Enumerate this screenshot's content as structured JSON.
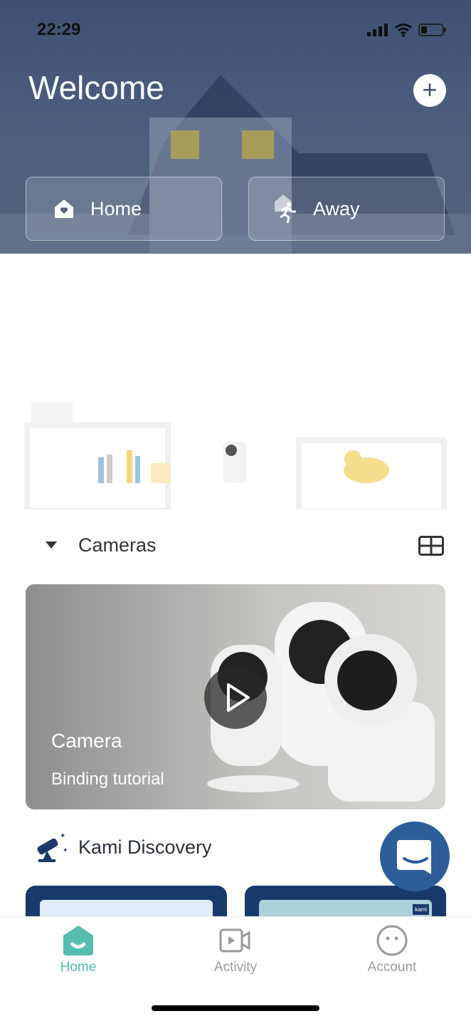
{
  "status_bar": {
    "time": "22:29"
  },
  "header": {
    "title": "Welcome",
    "add_icon": "plus-icon"
  },
  "modes": [
    {
      "label": "Home",
      "icon": "home-heart-icon"
    },
    {
      "label": "Away",
      "icon": "running-person-icon"
    }
  ],
  "cameras_section": {
    "title": "Cameras",
    "collapse_icon": "triangle-down-icon",
    "layout_icon": "grid-icon"
  },
  "banner": {
    "title": "Camera",
    "subtitle": "Binding tutorial",
    "play_icon": "play-icon"
  },
  "discovery": {
    "title": "Kami Discovery",
    "icon": "telescope-icon",
    "card_badge": "kami"
  },
  "chat": {
    "icon": "chat-smile-icon",
    "color": "#2e5e9a"
  },
  "tabs": [
    {
      "label": "Home",
      "active": true
    },
    {
      "label": "Activity",
      "active": false
    },
    {
      "label": "Account",
      "active": false
    }
  ],
  "colors": {
    "accent": "#55bcae",
    "inactive": "#9a9a9a",
    "navy": "#173a6a"
  }
}
